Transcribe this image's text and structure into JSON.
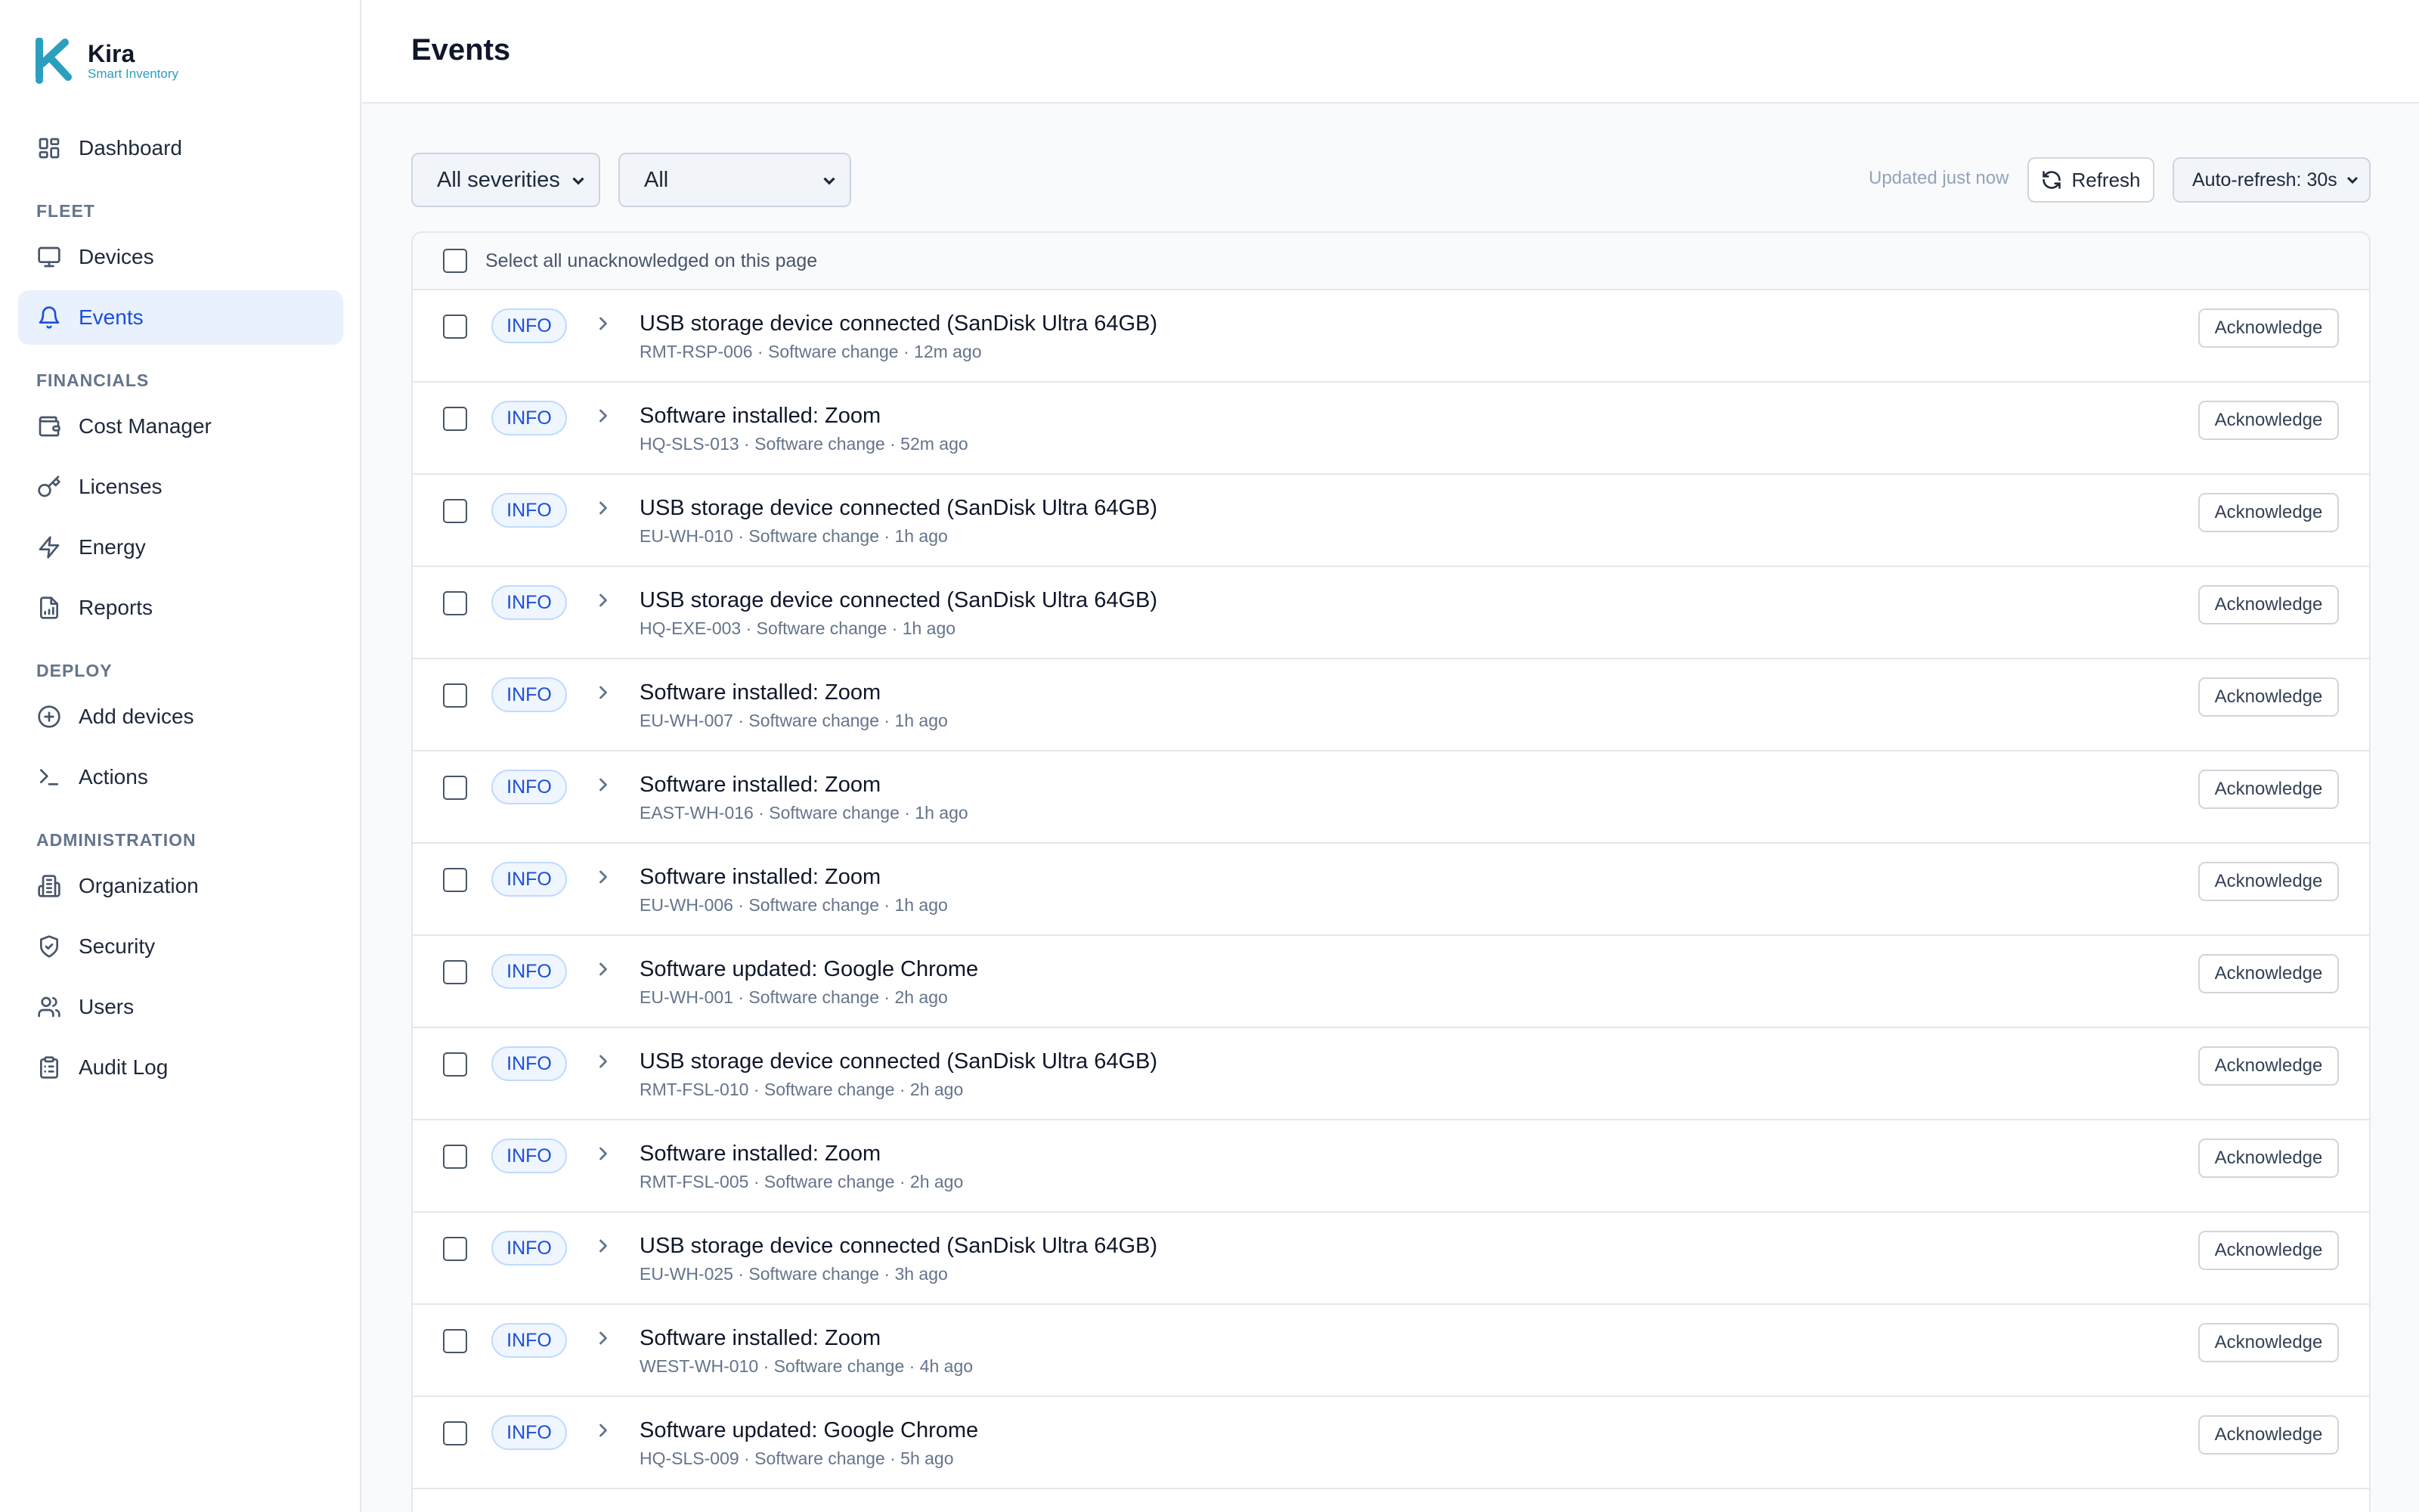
{
  "app": {
    "name": "Kira",
    "tagline": "Smart Inventory"
  },
  "sidebar": {
    "top": [
      {
        "label": "Dashboard",
        "icon": "dashboard-icon"
      }
    ],
    "sections": [
      {
        "title": "FLEET",
        "items": [
          {
            "label": "Devices",
            "icon": "monitor-icon"
          },
          {
            "label": "Events",
            "icon": "bell-icon",
            "active": true
          }
        ]
      },
      {
        "title": "FINANCIALS",
        "items": [
          {
            "label": "Cost Manager",
            "icon": "wallet-icon"
          },
          {
            "label": "Licenses",
            "icon": "key-icon"
          },
          {
            "label": "Energy",
            "icon": "lightning-icon"
          },
          {
            "label": "Reports",
            "icon": "report-icon"
          }
        ]
      },
      {
        "title": "DEPLOY",
        "items": [
          {
            "label": "Add devices",
            "icon": "plus-circle-icon"
          },
          {
            "label": "Actions",
            "icon": "terminal-icon"
          }
        ]
      },
      {
        "title": "ADMINISTRATION",
        "items": [
          {
            "label": "Organization",
            "icon": "building-icon"
          },
          {
            "label": "Security",
            "icon": "shield-icon"
          },
          {
            "label": "Users",
            "icon": "users-icon"
          },
          {
            "label": "Audit Log",
            "icon": "clipboard-icon"
          }
        ]
      }
    ]
  },
  "header": {
    "title": "Events"
  },
  "filters": {
    "severity": "All severities",
    "status": "All",
    "updated": "Updated just now",
    "refresh_label": "Refresh",
    "auto_refresh": "Auto-refresh: 30s"
  },
  "list": {
    "select_all_label": "Select all unacknowledged on this page",
    "ack_label": "Acknowledge",
    "events": [
      {
        "severity": "INFO",
        "title": "USB storage device connected (SanDisk Ultra 64GB)",
        "meta": "RMT-RSP-006 · Software change · 12m ago"
      },
      {
        "severity": "INFO",
        "title": "Software installed: Zoom",
        "meta": "HQ-SLS-013 · Software change · 52m ago"
      },
      {
        "severity": "INFO",
        "title": "USB storage device connected (SanDisk Ultra 64GB)",
        "meta": "EU-WH-010 · Software change · 1h ago"
      },
      {
        "severity": "INFO",
        "title": "USB storage device connected (SanDisk Ultra 64GB)",
        "meta": "HQ-EXE-003 · Software change · 1h ago"
      },
      {
        "severity": "INFO",
        "title": "Software installed: Zoom",
        "meta": "EU-WH-007 · Software change · 1h ago"
      },
      {
        "severity": "INFO",
        "title": "Software installed: Zoom",
        "meta": "EAST-WH-016 · Software change · 1h ago"
      },
      {
        "severity": "INFO",
        "title": "Software installed: Zoom",
        "meta": "EU-WH-006 · Software change · 1h ago"
      },
      {
        "severity": "INFO",
        "title": "Software updated: Google Chrome",
        "meta": "EU-WH-001 · Software change · 2h ago"
      },
      {
        "severity": "INFO",
        "title": "USB storage device connected (SanDisk Ultra 64GB)",
        "meta": "RMT-FSL-010 · Software change · 2h ago"
      },
      {
        "severity": "INFO",
        "title": "Software installed: Zoom",
        "meta": "RMT-FSL-005 · Software change · 2h ago"
      },
      {
        "severity": "INFO",
        "title": "USB storage device connected (SanDisk Ultra 64GB)",
        "meta": "EU-WH-025 · Software change · 3h ago"
      },
      {
        "severity": "INFO",
        "title": "Software installed: Zoom",
        "meta": "WEST-WH-010 · Software change · 4h ago"
      },
      {
        "severity": "INFO",
        "title": "Software updated: Google Chrome",
        "meta": "HQ-SLS-009 · Software change · 5h ago"
      }
    ]
  },
  "colors": {
    "accent": "#1d4ed8",
    "brand": "#2a9fbf",
    "active_bg": "#e8f1fd"
  }
}
